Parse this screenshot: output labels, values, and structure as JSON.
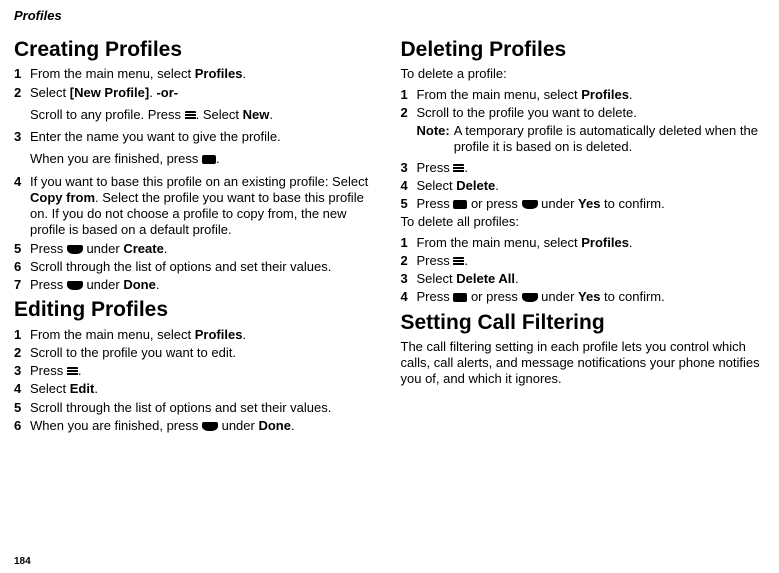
{
  "running_head": "Profiles",
  "page_number": "184",
  "left": {
    "h_creating": "Creating Profiles",
    "creating": {
      "s1a": "From the main menu, select ",
      "s1b": "Profiles",
      "s1c": ".",
      "s2a": "Select ",
      "s2b": "[New Profile]",
      "s2c": ". ",
      "s2d": "-or-",
      "s2sub_a": "Scroll to any profile. Press ",
      "s2sub_b": ". Select ",
      "s2sub_c": "New",
      "s2sub_d": ".",
      "s3": "Enter the name you want to give the profile.",
      "s3sub_a": "When you are finished, press ",
      "s3sub_b": ".",
      "s4a": "If you want to base this profile on an existing profile: Select ",
      "s4b": "Copy from",
      "s4c": ". Select the profile you want to base this profile on. If you do not choose a profile to copy from, the new profile is based on a default profile.",
      "s5a": "Press ",
      "s5b": " under ",
      "s5c": "Create",
      "s5d": ".",
      "s6": "Scroll through the list of options and set their values.",
      "s7a": "Press ",
      "s7b": " under ",
      "s7c": "Done",
      "s7d": "."
    },
    "h_editing": "Editing Profiles",
    "editing": {
      "s1a": "From the main menu, select ",
      "s1b": "Profiles",
      "s1c": ".",
      "s2": "Scroll to the profile you want to edit.",
      "s3a": "Press ",
      "s3b": ".",
      "s4a": "Select ",
      "s4b": "Edit",
      "s4c": ".",
      "s5": "Scroll through the list of options and set their values.",
      "s6a": "When you are finished, press ",
      "s6b": " under ",
      "s6c": "Done",
      "s6d": "."
    }
  },
  "right": {
    "h_deleting": "Deleting Profiles",
    "intro_delete_one": "To delete a profile:",
    "del_one": {
      "s1a": "From the main menu, select ",
      "s1b": "Profiles",
      "s1c": ".",
      "s2": "Scroll to the profile you want to delete.",
      "note_label": "Note:",
      "note_text": "A temporary profile is automatically deleted when the profile it is based on is deleted.",
      "s3a": "Press ",
      "s3b": ".",
      "s4a": "Select ",
      "s4b": "Delete",
      "s4c": ".",
      "s5a": "Press ",
      "s5b": " or press ",
      "s5c": " under ",
      "s5d": "Yes",
      "s5e": " to confirm."
    },
    "intro_delete_all": "To delete all profiles:",
    "del_all": {
      "s1a": "From the main menu, select ",
      "s1b": "Profiles",
      "s1c": ".",
      "s2a": "Press ",
      "s2b": ".",
      "s3a": "Select ",
      "s3b": "Delete All",
      "s3c": ".",
      "s4a": "Press ",
      "s4b": " or press ",
      "s4c": " under ",
      "s4d": "Yes",
      "s4e": " to confirm."
    },
    "h_filtering": "Setting Call Filtering",
    "filtering_body": "The call filtering setting in each profile lets you control which calls, call alerts, and message notifications your phone notifies you of, and which it ignores."
  }
}
